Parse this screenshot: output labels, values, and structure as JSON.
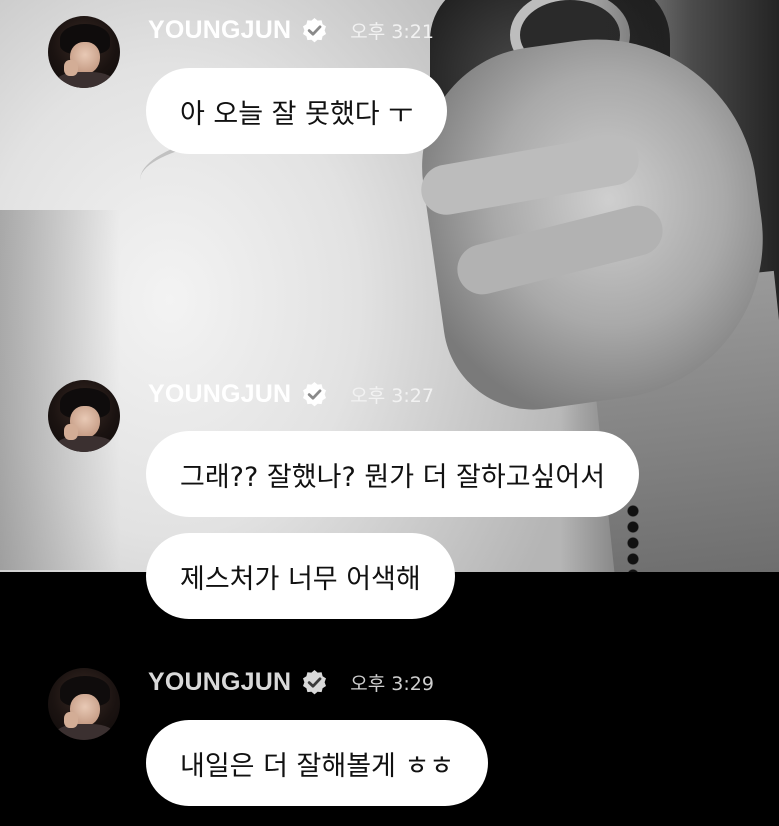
{
  "messages": [
    {
      "sender": "YOUNGJUN",
      "time": "오후 3:21",
      "bubbles": [
        "아 오늘 잘 못했다 ㅜ"
      ]
    },
    {
      "sender": "YOUNGJUN",
      "time": "오후 3:27",
      "bubbles": [
        "그래?? 잘했나? 뭔가 더 잘하고싶어서",
        "제스처가 너무 어색해"
      ]
    },
    {
      "sender": "YOUNGJUN",
      "time": "오후 3:29",
      "bubbles": [
        "내일은 더 잘해볼게 ㅎㅎ"
      ]
    }
  ],
  "icons": {
    "verified": "verified-check-badge-icon"
  },
  "colors": {
    "bubble": "#ffffff",
    "bubble_text": "#111111",
    "dark_background": "#000000"
  }
}
